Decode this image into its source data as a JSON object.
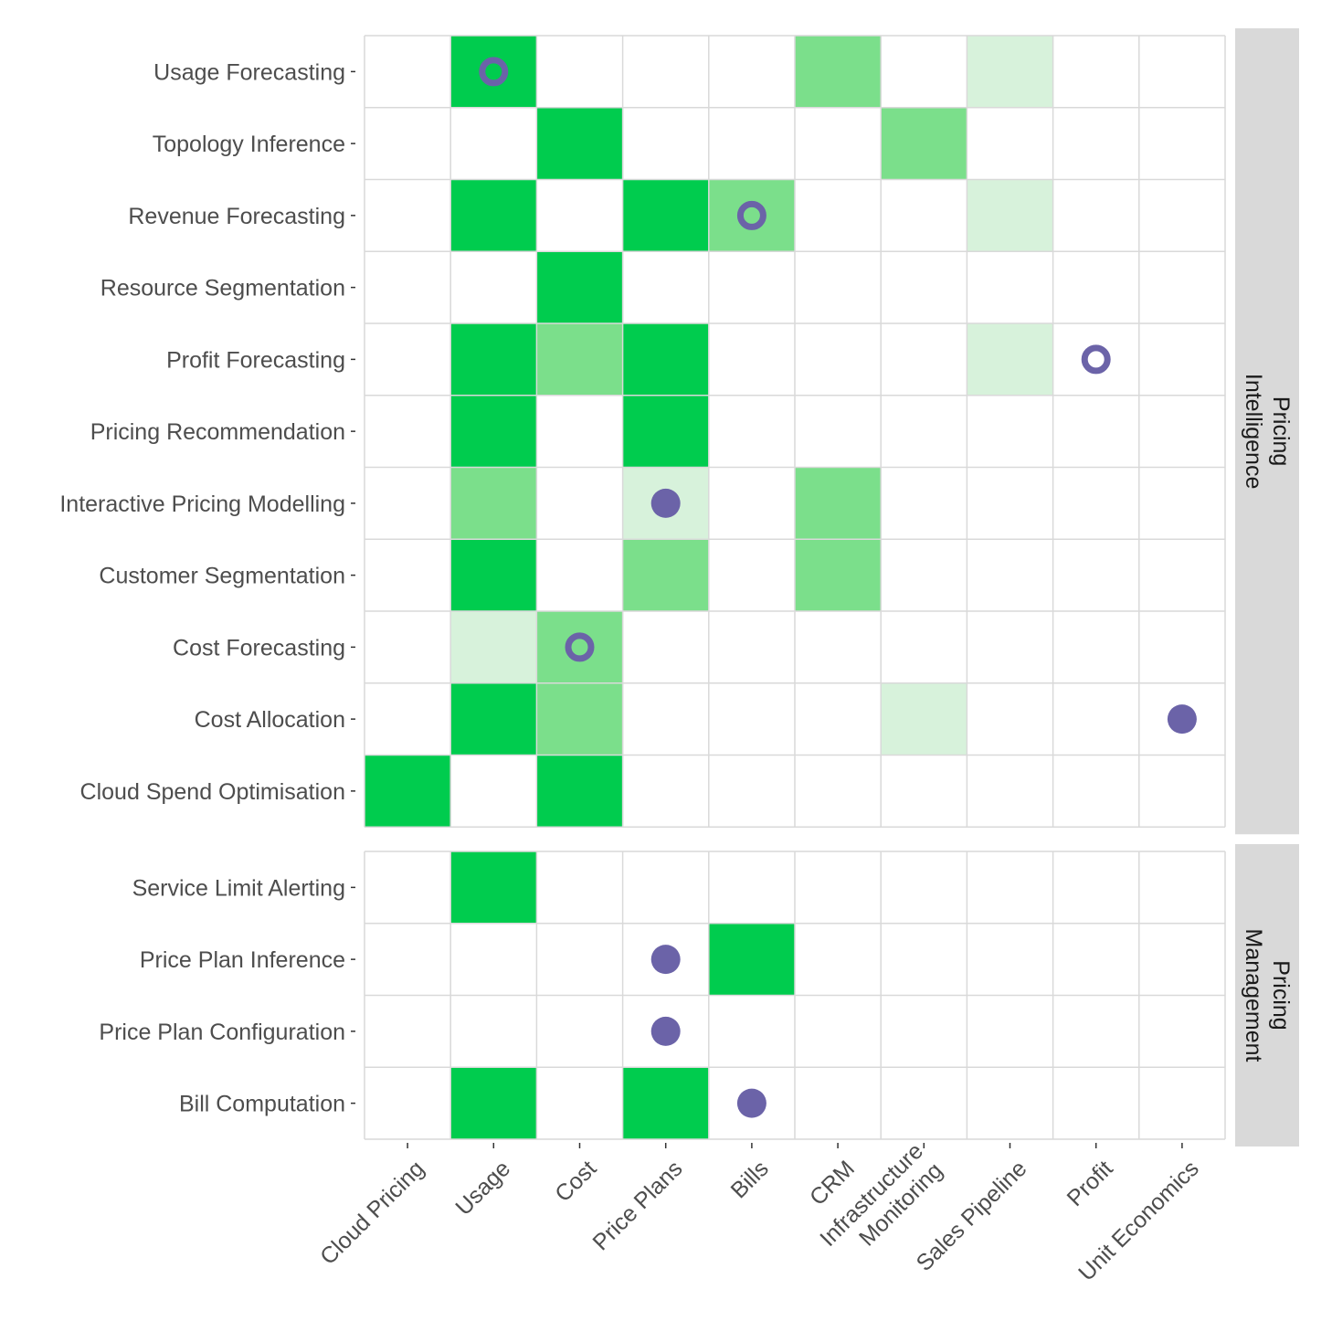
{
  "chart_data": {
    "type": "heatmap",
    "title": "",
    "xlabel": "",
    "ylabel": "",
    "grid": true,
    "legend": "none",
    "colors": {
      "level_3": "#00CC4E",
      "level_2": "#7BDF8B",
      "level_1": "#D7F2DB",
      "empty": "#FFFFFF",
      "marker": "#6B63A8",
      "grid": "#D9D9D9",
      "strip_bg": "#D9D9D9"
    },
    "fill_scale_note": "0 = none, 1 = light, 2 = medium, 3 = strong",
    "marker_types": {
      "filled": "solid circle",
      "hollow": "ring"
    },
    "columns": [
      "Cloud Pricing",
      "Usage",
      "Cost",
      "Price Plans",
      "Bills",
      "CRM",
      "Infrastructure\nMonitoring",
      "Sales Pipeline",
      "Profit",
      "Unit Economics"
    ],
    "panels": [
      {
        "name": "Pricing\nIntelligence",
        "rows": [
          {
            "label": "Usage Forecasting",
            "values": [
              0,
              3,
              0,
              0,
              0,
              2,
              0,
              1,
              0,
              0
            ],
            "markers": [
              {
                "col": 1,
                "type": "hollow"
              }
            ]
          },
          {
            "label": "Topology Inference",
            "values": [
              0,
              0,
              3,
              0,
              0,
              0,
              2,
              0,
              0,
              0
            ],
            "markers": []
          },
          {
            "label": "Revenue Forecasting",
            "values": [
              0,
              3,
              0,
              3,
              2,
              0,
              0,
              1,
              0,
              0
            ],
            "markers": [
              {
                "col": 4,
                "type": "hollow"
              }
            ]
          },
          {
            "label": "Resource Segmentation",
            "values": [
              0,
              0,
              3,
              0,
              0,
              0,
              0,
              0,
              0,
              0
            ],
            "markers": []
          },
          {
            "label": "Profit Forecasting",
            "values": [
              0,
              3,
              2,
              3,
              0,
              0,
              0,
              1,
              0,
              0
            ],
            "markers": [
              {
                "col": 8,
                "type": "hollow"
              }
            ]
          },
          {
            "label": "Pricing Recommendation",
            "values": [
              0,
              3,
              0,
              3,
              0,
              0,
              0,
              0,
              0,
              0
            ],
            "markers": []
          },
          {
            "label": "Interactive Pricing Modelling",
            "values": [
              0,
              2,
              0,
              1,
              0,
              2,
              0,
              0,
              0,
              0
            ],
            "markers": [
              {
                "col": 3,
                "type": "filled"
              }
            ]
          },
          {
            "label": "Customer Segmentation",
            "values": [
              0,
              3,
              0,
              2,
              0,
              2,
              0,
              0,
              0,
              0
            ],
            "markers": []
          },
          {
            "label": "Cost Forecasting",
            "values": [
              0,
              1,
              2,
              0,
              0,
              0,
              0,
              0,
              0,
              0
            ],
            "markers": [
              {
                "col": 2,
                "type": "hollow"
              }
            ]
          },
          {
            "label": "Cost Allocation",
            "values": [
              0,
              3,
              2,
              0,
              0,
              0,
              1,
              0,
              0,
              0
            ],
            "markers": [
              {
                "col": 9,
                "type": "filled"
              }
            ]
          },
          {
            "label": "Cloud Spend Optimisation",
            "values": [
              3,
              0,
              3,
              0,
              0,
              0,
              0,
              0,
              0,
              0
            ],
            "markers": []
          }
        ]
      },
      {
        "name": "Pricing\nManagement",
        "rows": [
          {
            "label": "Service Limit Alerting",
            "values": [
              0,
              3,
              0,
              0,
              0,
              0,
              0,
              0,
              0,
              0
            ],
            "markers": []
          },
          {
            "label": "Price Plan Inference",
            "values": [
              0,
              0,
              0,
              0,
              3,
              0,
              0,
              0,
              0,
              0
            ],
            "markers": [
              {
                "col": 3,
                "type": "filled"
              }
            ]
          },
          {
            "label": "Price Plan Configuration",
            "values": [
              0,
              0,
              0,
              0,
              0,
              0,
              0,
              0,
              0,
              0
            ],
            "markers": [
              {
                "col": 3,
                "type": "filled"
              }
            ]
          },
          {
            "label": "Bill Computation",
            "values": [
              0,
              3,
              0,
              3,
              0,
              0,
              0,
              0,
              0,
              0
            ],
            "markers": [
              {
                "col": 4,
                "type": "filled"
              }
            ]
          }
        ]
      }
    ]
  }
}
